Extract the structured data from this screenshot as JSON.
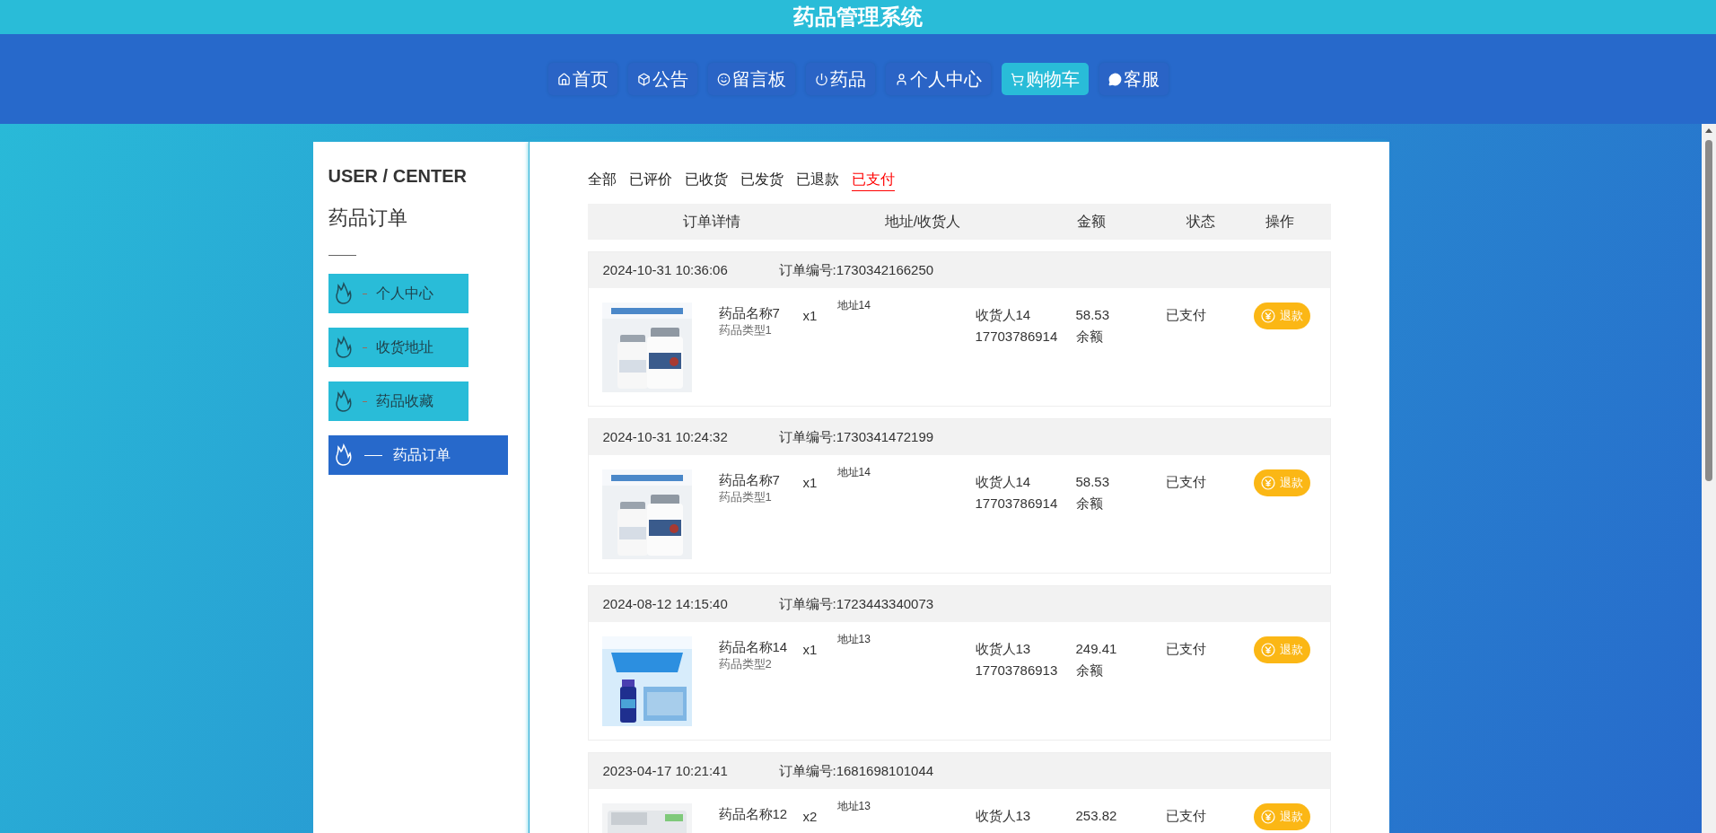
{
  "site_title": "药品管理系统",
  "nav": [
    {
      "label": "首页",
      "selected": false
    },
    {
      "label": "公告",
      "selected": false
    },
    {
      "label": "留言板",
      "selected": false
    },
    {
      "label": "药品",
      "selected": false
    },
    {
      "label": "个人中心",
      "selected": false
    },
    {
      "label": "购物车",
      "selected": true
    },
    {
      "label": "客服",
      "selected": false
    }
  ],
  "sidebar": {
    "heading": "USER / CENTER",
    "subtitle": "药品订单",
    "items": [
      {
        "label": "个人中心",
        "selected": false
      },
      {
        "label": "收货地址",
        "selected": false
      },
      {
        "label": "药品收藏",
        "selected": false
      },
      {
        "label": "药品订单",
        "selected": true
      }
    ]
  },
  "tabs": [
    {
      "label": "全部",
      "selected": false
    },
    {
      "label": "已评价",
      "selected": false
    },
    {
      "label": "已收货",
      "selected": false
    },
    {
      "label": "已发货",
      "selected": false
    },
    {
      "label": "已退款",
      "selected": false
    },
    {
      "label": "已支付",
      "selected": true
    }
  ],
  "table": {
    "columns": [
      "订单详情",
      "地址/收货人",
      "金额",
      "状态",
      "操作"
    ]
  },
  "orders": [
    {
      "time": "2024-10-31 10:36:06",
      "order_no": "订单编号:1730342166250",
      "product": "药品名称7",
      "type": "药品类型1",
      "qty": "x1",
      "address": "地址14",
      "receiver": "收货人14",
      "phone": "17703786914",
      "amount": "58.53",
      "pay": "余额",
      "status": "已支付",
      "action": "退款",
      "kind": "picture"
    },
    {
      "time": "2024-10-31 10:24:32",
      "order_no": "订单编号:1730341472199",
      "product": "药品名称7",
      "type": "药品类型1",
      "qty": "x1",
      "address": "地址14",
      "receiver": "收货人14",
      "phone": "17703786914",
      "amount": "58.53",
      "pay": "余额",
      "status": "已支付",
      "action": "退款",
      "kind": "picture"
    },
    {
      "time": "2024-08-12 14:15:40",
      "order_no": "订单编号:1723443340073",
      "product": "药品名称14",
      "type": "药品类型2",
      "qty": "x1",
      "address": "地址13",
      "receiver": "收货人13",
      "phone": "17703786913",
      "amount": "249.41",
      "pay": "余额",
      "status": "已支付",
      "action": "退款",
      "kind": "picture"
    },
    {
      "time": "2023-04-17 10:21:41",
      "order_no": "订单编号:1681698101044",
      "product": "药品名称12",
      "qty": "x2",
      "address": "地址13",
      "receiver": "收货人13",
      "amount": "253.82",
      "status": "已支付",
      "action": "退款",
      "kind": "picture"
    }
  ]
}
